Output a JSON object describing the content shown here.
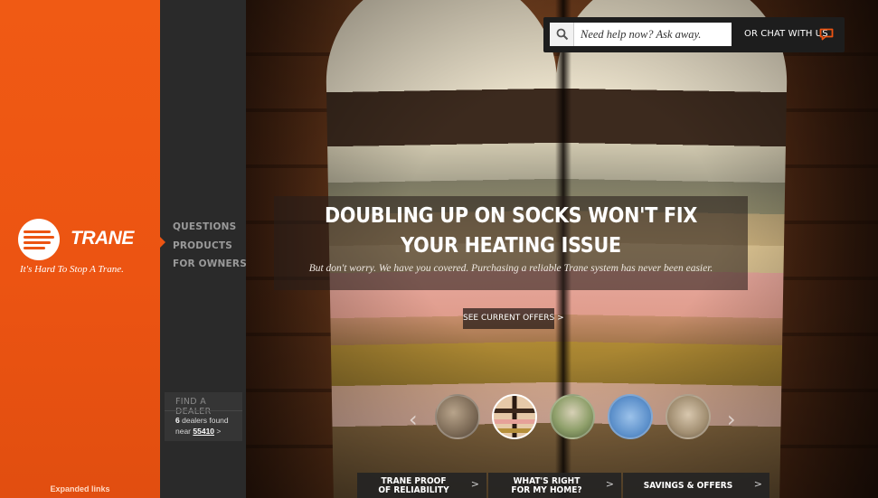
{
  "brand": {
    "logo_text": "TRANE",
    "tagline": "It's Hard To Stop A Trane.",
    "expanded_links": "Expanded links",
    "color": "#ec5412"
  },
  "nav": {
    "items": [
      {
        "label": "QUESTIONS"
      },
      {
        "label": "PRODUCTS"
      },
      {
        "label": "FOR OWNERS"
      }
    ]
  },
  "dealer": {
    "title": "FIND A DEALER",
    "count": "6",
    "found_text": "dealers found",
    "near_text": "near",
    "zip": "55410",
    "chevron": ">"
  },
  "search": {
    "placeholder": "Need help now? Ask away.",
    "icon": "search-icon"
  },
  "chat": {
    "label": "OR CHAT WITH US",
    "icon": "chat-bubble-icon"
  },
  "hero": {
    "headline_line1": "DOUBLING UP ON SOCKS WON'T FIX",
    "headline_line2": "YOUR HEATING ISSUE",
    "subhead": "But don't worry. We have you covered. Purchasing a reliable Trane system has never been easier.",
    "cta_label": "SEE CURRENT OFFERS",
    "cta_chevron": ">"
  },
  "carousel": {
    "prev": "‹",
    "next": "›",
    "active_index": 1,
    "slide_count": 5
  },
  "tabs": [
    {
      "line1": "TRANE PROOF",
      "line2": "OF RELIABILITY",
      "chevron": ">"
    },
    {
      "line1": "WHAT'S RIGHT",
      "line2": "FOR MY HOME?",
      "chevron": ">"
    },
    {
      "line1": "SAVINGS & OFFERS",
      "line2": "",
      "chevron": ">"
    }
  ]
}
